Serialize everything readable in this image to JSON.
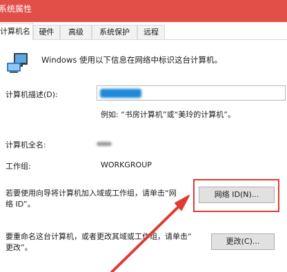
{
  "window": {
    "title": "系统属性"
  },
  "tabs": [
    {
      "label": "计算机名",
      "active": true
    },
    {
      "label": "硬件",
      "active": false
    },
    {
      "label": "高级",
      "active": false
    },
    {
      "label": "系统保护",
      "active": false
    },
    {
      "label": "远程",
      "active": false
    }
  ],
  "intro": {
    "text": "Windows 使用以下信息在网络中标识这台计算机。",
    "icon": "computer-icon"
  },
  "description": {
    "label": "计算机描述(D):",
    "example": "例如: “书房计算机”或“美玲的计算机”。"
  },
  "full_name": {
    "label": "计算机全名:"
  },
  "workgroup": {
    "label": "工作组:",
    "value": "WORKGROUP"
  },
  "join_domain": {
    "line1": "若要使用向导将计算机加入域或工作组，请单击“网",
    "line2": "络 ID”。",
    "button": "网络 ID(N)..."
  },
  "rename": {
    "line1": "要重命名这台计算机，或者更改其域或工作组，请单击“",
    "line2": "更改”。",
    "button": "更改(C)..."
  },
  "colors": {
    "title_bar": "#e24f49",
    "highlight": "#d83a34",
    "accent": "#1e8ad8"
  }
}
